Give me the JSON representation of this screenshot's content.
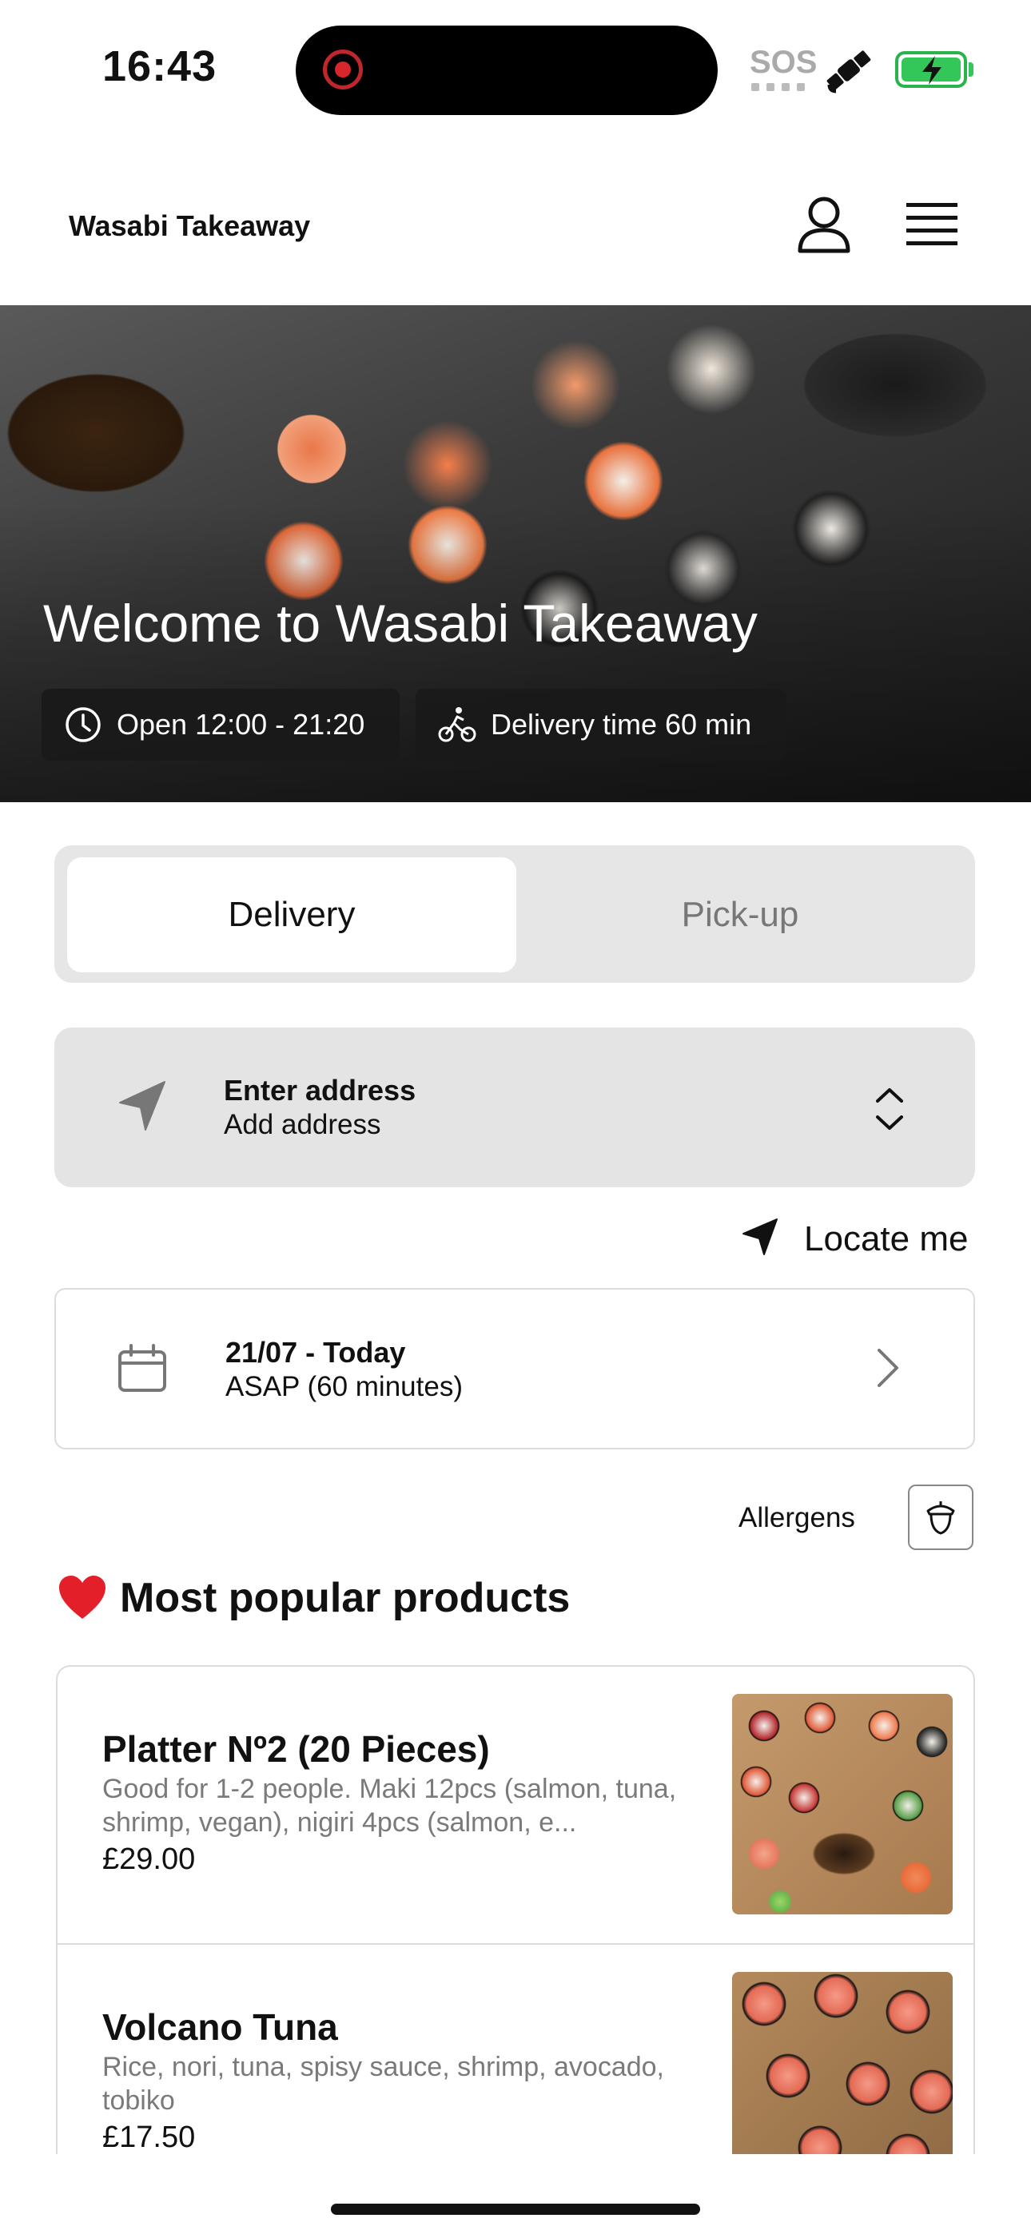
{
  "status_bar": {
    "time": "16:43",
    "sos": "SOS",
    "icons": [
      "recording-indicator-icon",
      "satellite-icon",
      "battery-charging-icon"
    ],
    "colors": {
      "recording": "#d8262d",
      "battery": "#33c759"
    }
  },
  "header": {
    "brand": "Wasabi Takeaway",
    "icons": [
      "user-icon",
      "menu-icon"
    ]
  },
  "hero": {
    "title": "Welcome to Wasabi Takeaway",
    "open_hours": "Open 12:00 - 21:20",
    "delivery_time": "Delivery time 60 min"
  },
  "order_mode": {
    "options": [
      "Delivery",
      "Pick-up"
    ],
    "selected": "Delivery"
  },
  "address": {
    "title": "Enter address",
    "subtitle": "Add address",
    "locate_label": "Locate me"
  },
  "schedule": {
    "date": "21/07 - Today",
    "time": "ASAP (60 minutes)"
  },
  "allergens": {
    "label": "Allergens"
  },
  "popular": {
    "emoji": "❤️",
    "title": "Most popular products",
    "products": [
      {
        "name": "Platter Nº2 (20 Pieces)",
        "description": "Good for 1-2 people. Maki 12pcs (salmon, tuna, shrimp, vegan), nigiri 4pcs (salmon, e...",
        "price": "£29.00"
      },
      {
        "name": "Volcano Tuna",
        "description": "Rice, nori, tuna, spisy sauce, shrimp, avocado, tobiko",
        "price": "£17.50"
      }
    ]
  }
}
